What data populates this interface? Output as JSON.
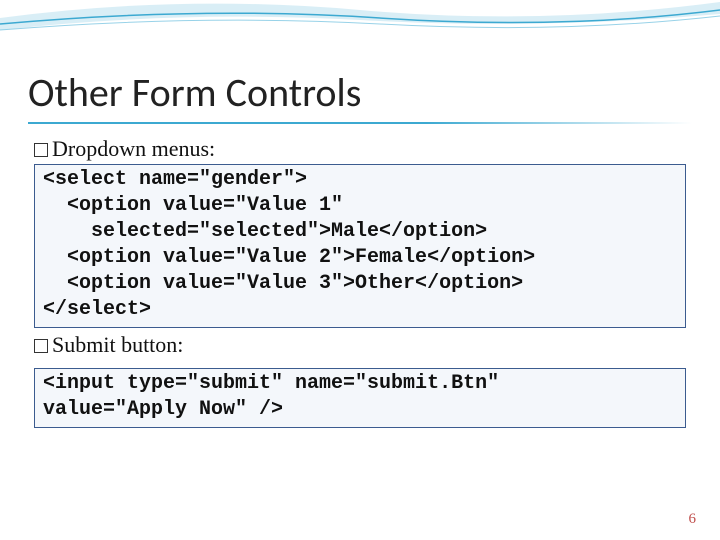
{
  "title": "Other Form Controls",
  "bullets": {
    "dropdown": "Dropdown menus:",
    "submit": "Submit button:"
  },
  "code": {
    "select": "<select name=\"gender\">\n  <option value=\"Value 1\"\n    selected=\"selected\">Male</option>\n  <option value=\"Value 2\">Female</option>\n  <option value=\"Value 3\">Other</option>\n</select>",
    "submit": "<input type=\"submit\" name=\"submit.Btn\"\nvalue=\"Apply Now\" />"
  },
  "page_number": "6"
}
